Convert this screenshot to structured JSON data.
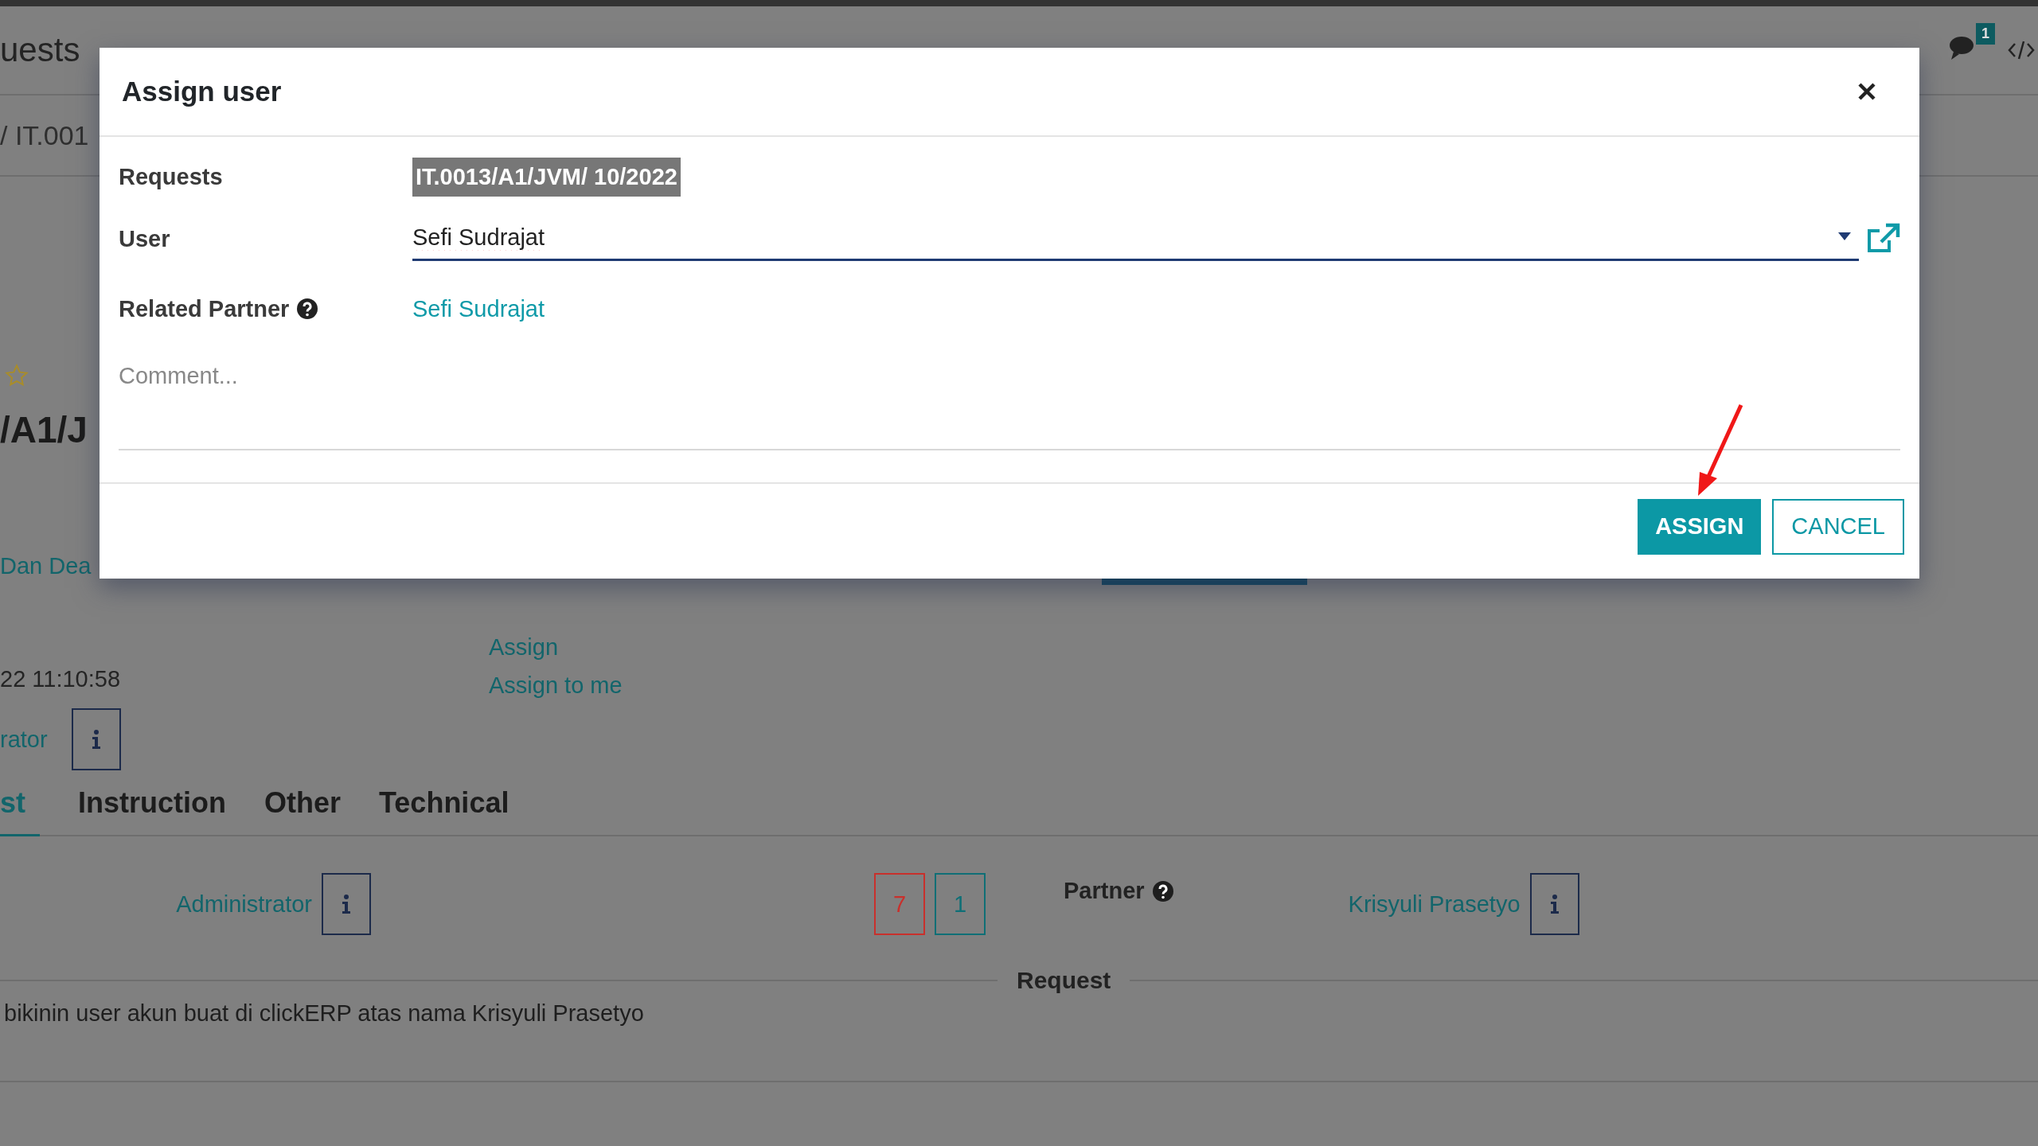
{
  "app_header": {
    "title": "uests",
    "messages_badge": "1"
  },
  "breadcrumb": "/ IT.001",
  "record": {
    "starred": false,
    "title": "/A1/J",
    "deadline_link": "Dan Dea",
    "date": "22 11:10:58",
    "user_link": "rator",
    "actions": [
      "Assign",
      "Assign to me"
    ]
  },
  "tabs": [
    {
      "label": "st",
      "selected": true
    },
    {
      "label": "Instruction",
      "selected": false
    },
    {
      "label": "Other",
      "selected": false
    },
    {
      "label": "Technical",
      "selected": false
    }
  ],
  "tab_content": {
    "responsible": "Administrator",
    "counters": [
      {
        "value": "7",
        "color": "#c9302c"
      },
      {
        "value": "1",
        "color": "#0f6f76"
      }
    ],
    "partner_label": "Partner",
    "partner": "Krisyuli Prasetyo",
    "section_title": "Request",
    "description": "bikinin user akun buat di clickERP atas nama Krisyuli Prasetyo"
  },
  "dialog": {
    "title": "Assign user",
    "fields": [
      {
        "kind": "tag",
        "label": "Requests",
        "help": false,
        "value": "IT.0013/A1/JVM/ 10/2022"
      },
      {
        "kind": "select",
        "label": "User",
        "help": false,
        "value": "Sefi Sudrajat"
      },
      {
        "kind": "link",
        "label": "Related Partner",
        "help": true,
        "value": "Sefi Sudrajat"
      }
    ],
    "comment": {
      "placeholder": "Comment..."
    },
    "buttons": [
      {
        "label": "ASSIGN",
        "kind": "primary"
      },
      {
        "label": "CANCEL",
        "kind": "secondary"
      }
    ]
  }
}
